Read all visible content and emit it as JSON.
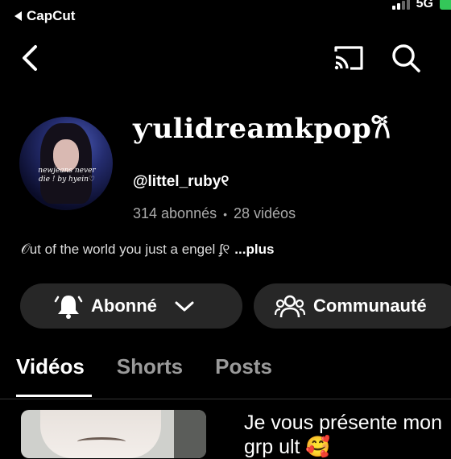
{
  "status_bar": {
    "back_app_label": "CapCut",
    "network": "5G"
  },
  "nav": {
    "icons": [
      "back-arrow-icon",
      "cast-icon",
      "search-icon"
    ]
  },
  "channel": {
    "name": "ƴulidreamkpop𐙚",
    "avatar_caption": "newjeans never die ! by hyein♡",
    "handle": "@littel_ruby୧",
    "subscribers": "314 abonnés",
    "separator": "•",
    "videos_count": "28 vidéos",
    "bio": "𝒪ut of the world you just a engel ʄ୧",
    "bio_more": "...plus"
  },
  "actions": {
    "subscribed_label": "Abonné",
    "community_label": "Communauté"
  },
  "tabs": [
    {
      "label": "Vidéos",
      "active": true
    },
    {
      "label": "Shorts",
      "active": false
    },
    {
      "label": "Posts",
      "active": false
    }
  ],
  "first_video": {
    "title": "Je vous présente mon grp ult 🥰"
  },
  "colors": {
    "background": "#000000",
    "button_bg": "#272727",
    "muted_text": "#aaaaaa",
    "battery": "#34c759"
  }
}
